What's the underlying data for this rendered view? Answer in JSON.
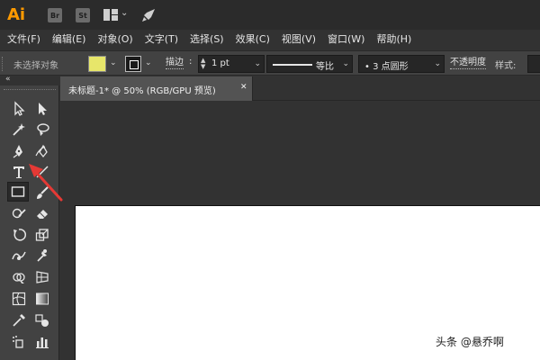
{
  "titlebar": {
    "app_logo": "Ai",
    "bridge_label": "Br",
    "stock_label": "St",
    "layout_chevron": "⌄"
  },
  "menubar": {
    "items": [
      {
        "label": "文件(F)"
      },
      {
        "label": "编辑(E)"
      },
      {
        "label": "对象(O)"
      },
      {
        "label": "文字(T)"
      },
      {
        "label": "选择(S)"
      },
      {
        "label": "效果(C)"
      },
      {
        "label": "视图(V)"
      },
      {
        "label": "窗口(W)"
      },
      {
        "label": "帮助(H)"
      }
    ]
  },
  "controlbar": {
    "no_selection": "未选择对象",
    "fill_color": "#e7e66a",
    "stroke_label": "描边",
    "stroke_colon": ":",
    "stroke_weight": "1 pt",
    "profile_label": "等比",
    "brush_label": "• 3 点圆形",
    "opacity_label": "不透明度",
    "style_label": "样式:",
    "chevron": "⌄"
  },
  "toolpanel": {
    "collapse": "«",
    "active_tool": "rectangle-tool"
  },
  "document": {
    "tab_title": "未标题-1* @ 50% (RGB/GPU 预览)",
    "close_glyph": "✕"
  },
  "annotation": {
    "arrow_color": "#e53935"
  },
  "watermark": {
    "text": "头条 @悬乔啊"
  }
}
